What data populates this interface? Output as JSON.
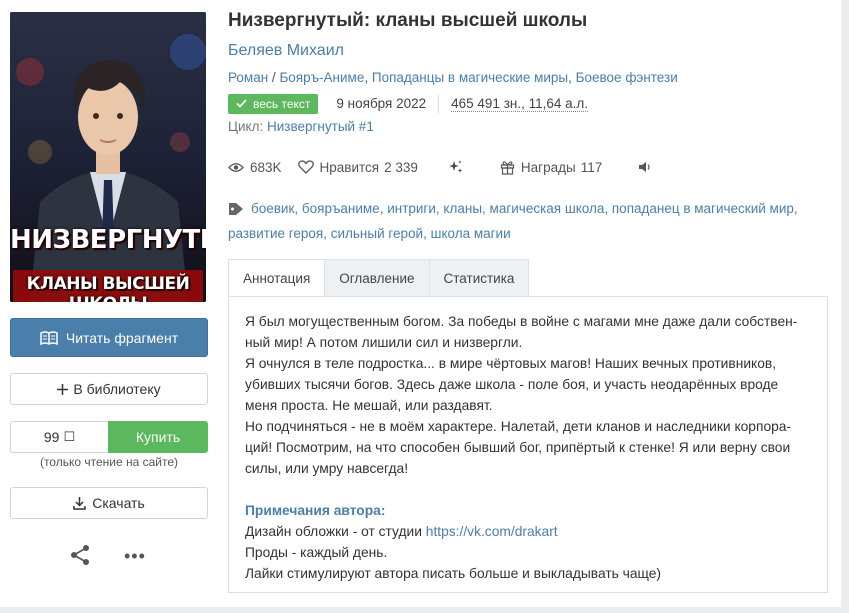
{
  "book": {
    "title": "Низвергнутый: кланы высшей школы",
    "author": "Беляев Михаил",
    "genres": [
      "Роман",
      "Бояръ-Аниме",
      "Попаданцы в магические миры",
      "Боевое фэнтези"
    ],
    "genre_sep": " / ",
    "badge": "весь текст",
    "date": "9 ноября 2022",
    "size": "465 491 зн., 11,64 а.л.",
    "cycle_label": "Цикл:",
    "cycle_name": "Низвергнутый #1"
  },
  "cover": {
    "line1": "НИЗВЕРГНУТЫЙ",
    "line2": "КЛАНЫ ВЫСШЕЙ ШКОЛЫ"
  },
  "stats": {
    "views": "683K",
    "likes_label": "Нравится",
    "likes_count": "2 339",
    "awards_label": "Награды",
    "awards_count": "117"
  },
  "tags": [
    "боевик",
    "бояръаниме",
    "интриги",
    "кланы",
    "магическая школа",
    "попаданец в магический мир",
    "развитие героя",
    "сильный герой",
    "школа магии"
  ],
  "actions": {
    "read": "Читать фрагмент",
    "library": "В библиотеку",
    "price": "99",
    "buy": "Купить",
    "buy_note": "(только чтение на сайте)",
    "download": "Скачать"
  },
  "tabs": [
    "Аннотация",
    "Оглавление",
    "Статистика"
  ],
  "annotation": {
    "p1": "Я был могущественным богом. За победы в войне с магами мне даже дали собствен-ный мир! А потом лишили сил и низвергли.",
    "p2": "Я очнулся в теле подростка... в мире чёртовых магов! Наших вечных противников, убивших тысячи богов. Здесь даже школа - поле боя, и участь неодарённых вроде меня проста. Не мешай, или раздавят.",
    "p3": "Но подчиняться - не в моём характере. Налетай, дети кланов и наследники корпора-ций! Посмотрим, на что способен бывший бог, припёртый к стенке! Я или верну свои силы, или умру навсегда!",
    "notes_heading": "Примечания автора:",
    "note1_prefix": "Дизайн обложки - от студии ",
    "note1_link": "https://vk.com/drakart",
    "note2": "Проды - каждый день.",
    "note3": "Лайки стимулируют автора писать больше и выкладывать чаще)"
  }
}
